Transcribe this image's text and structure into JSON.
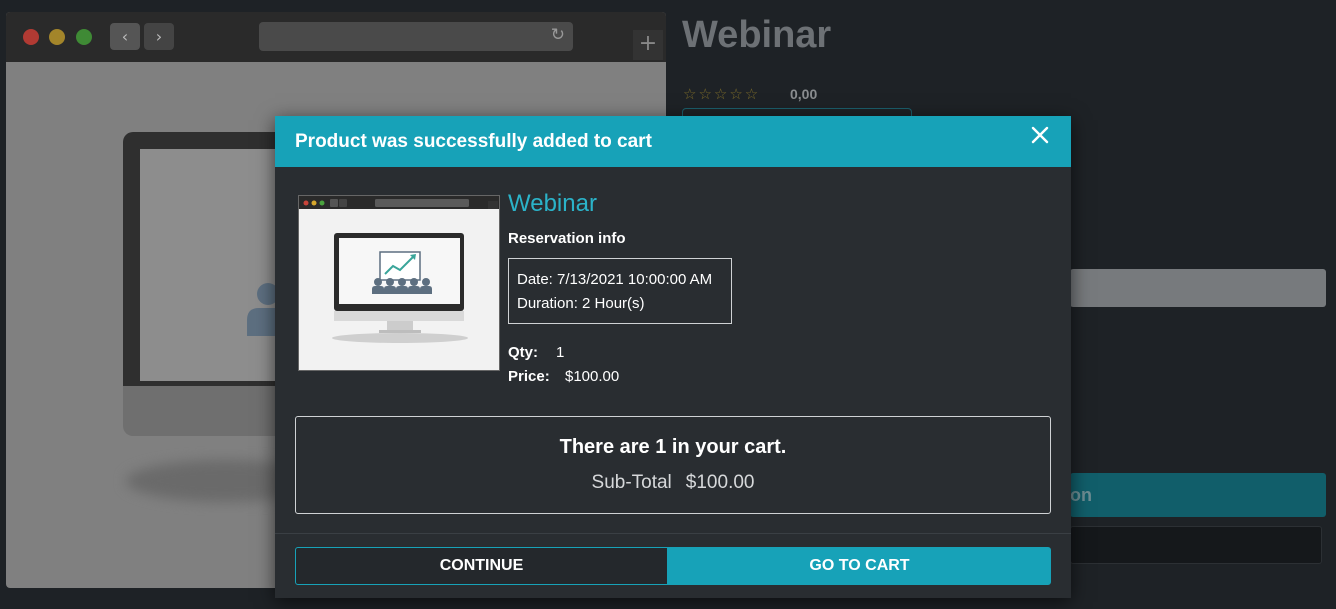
{
  "background_page": {
    "product_title": "Webinar",
    "rating_stars": "☆☆☆☆☆",
    "rating_value": "0,00",
    "add_button_partial": "on"
  },
  "modal": {
    "title": "Product was successfully added to cart",
    "product": {
      "name": "Webinar",
      "reservation_label": "Reservation info",
      "reservation_date": "Date: 7/13/2021 10:00:00 AM",
      "reservation_duration": "Duration: 2 Hour(s)",
      "qty_label": "Qty:",
      "qty_value": "1",
      "price_label": "Price:",
      "price_value": "$100.00"
    },
    "cart_summary": {
      "count_text": "There are 1 in your cart.",
      "subtotal_label": "Sub-Total",
      "subtotal_value": "$100.00"
    },
    "buttons": {
      "continue": "CONTINUE",
      "go_to_cart": "GO TO CART"
    }
  },
  "colors": {
    "accent": "#17a2b8",
    "modal_bg": "#292d31",
    "page_bg": "#1e2226"
  }
}
